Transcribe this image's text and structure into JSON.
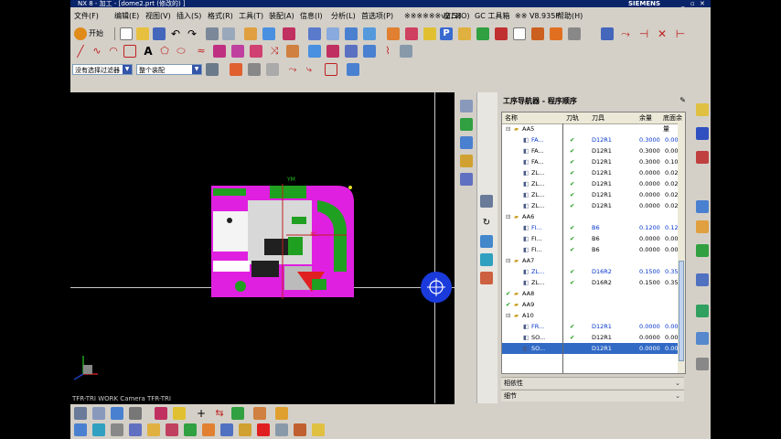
{
  "window": {
    "title": "NX 8 - 加工 - [dome2.prt (修改的) ]",
    "brand": "SIEMENS"
  },
  "menu": {
    "items": [
      "文件(F)",
      "编辑(E)",
      "视图(V)",
      "插入(S)",
      "格式(R)",
      "工具(T)",
      "装配(A)",
      "信息(I)",
      "分析(L)",
      "首选项(P)",
      "※※※※※※v2.58",
      "窗口(O)",
      "GC 工具箱",
      "※※ V8.935F",
      "帮助(H)"
    ]
  },
  "toolbar1": {
    "start_label": "开始"
  },
  "selection_bar": {
    "filter_value": "没有选择过滤器",
    "scope_value": "整个装配"
  },
  "viewport": {
    "status_text": "TFR-TRI WORK Camera TFR-TRI",
    "axis_label_ym": "YM",
    "axis_label_xc": "XC"
  },
  "navigator": {
    "title": "工序导航器 - 程序顺序",
    "columns": [
      "名称",
      "刀轨",
      "刀具",
      "余量",
      "底面余量"
    ],
    "rows": [
      {
        "indent": 1,
        "name": "AA5",
        "kind": "group",
        "check": "",
        "tool": "",
        "stock": "",
        "floor": "",
        "blue": false
      },
      {
        "indent": 2,
        "name": "FA...",
        "kind": "op",
        "check": "✔",
        "tool": "D12R1",
        "stock": "0.3000",
        "floor": "0.000",
        "blue": true
      },
      {
        "indent": 2,
        "name": "FA...",
        "kind": "op",
        "check": "✔",
        "tool": "D12R1",
        "stock": "0.3000",
        "floor": "0.000",
        "blue": false
      },
      {
        "indent": 2,
        "name": "FA...",
        "kind": "op",
        "check": "✔",
        "tool": "D12R1",
        "stock": "0.3000",
        "floor": "0.100",
        "blue": false
      },
      {
        "indent": 2,
        "name": "ZL...",
        "kind": "op",
        "check": "✔",
        "tool": "D12R1",
        "stock": "0.0000",
        "floor": "0.020",
        "blue": false
      },
      {
        "indent": 2,
        "name": "ZL...",
        "kind": "op",
        "check": "✔",
        "tool": "D12R1",
        "stock": "0.0000",
        "floor": "0.020",
        "blue": false
      },
      {
        "indent": 2,
        "name": "ZL...",
        "kind": "op",
        "check": "✔",
        "tool": "D12R1",
        "stock": "0.0000",
        "floor": "0.020",
        "blue": false
      },
      {
        "indent": 2,
        "name": "ZL...",
        "kind": "op",
        "check": "✔",
        "tool": "D12R1",
        "stock": "0.0000",
        "floor": "0.020",
        "blue": false
      },
      {
        "indent": 1,
        "name": "AA6",
        "kind": "group",
        "check": "",
        "tool": "",
        "stock": "",
        "floor": "",
        "blue": false
      },
      {
        "indent": 2,
        "name": "FI...",
        "kind": "op",
        "check": "✔",
        "tool": "B6",
        "stock": "0.1200",
        "floor": "0.120",
        "blue": true
      },
      {
        "indent": 2,
        "name": "FI...",
        "kind": "op",
        "check": "✔",
        "tool": "B6",
        "stock": "0.0000",
        "floor": "0.000",
        "blue": false
      },
      {
        "indent": 2,
        "name": "FI...",
        "kind": "op",
        "check": "✔",
        "tool": "B6",
        "stock": "0.0000",
        "floor": "0.000",
        "blue": false
      },
      {
        "indent": 1,
        "name": "AA7",
        "kind": "group",
        "check": "",
        "tool": "",
        "stock": "",
        "floor": "",
        "blue": false
      },
      {
        "indent": 2,
        "name": "ZL...",
        "kind": "op",
        "check": "✔",
        "tool": "D16R2",
        "stock": "0.1500",
        "floor": "0.350",
        "blue": true
      },
      {
        "indent": 2,
        "name": "ZL...",
        "kind": "op",
        "check": "✔",
        "tool": "D16R2",
        "stock": "0.1500",
        "floor": "0.350",
        "blue": false
      },
      {
        "indent": 1,
        "name": "AA8",
        "kind": "group-check",
        "check": "",
        "tool": "",
        "stock": "",
        "floor": "",
        "blue": false
      },
      {
        "indent": 1,
        "name": "AA9",
        "kind": "group-check",
        "check": "",
        "tool": "",
        "stock": "",
        "floor": "",
        "blue": false
      },
      {
        "indent": 1,
        "name": "A10",
        "kind": "group",
        "check": "",
        "tool": "",
        "stock": "",
        "floor": "",
        "blue": false
      },
      {
        "indent": 2,
        "name": "FR...",
        "kind": "op",
        "check": "✔",
        "tool": "D12R1",
        "stock": "0.0000",
        "floor": "0.000",
        "blue": true
      },
      {
        "indent": 2,
        "name": "SO...",
        "kind": "op",
        "check": "✔",
        "tool": "D12R1",
        "stock": "0.0000",
        "floor": "0.000",
        "blue": false
      },
      {
        "indent": 2,
        "name": "SO...",
        "kind": "op-selected",
        "check": "",
        "tool": "D12R1",
        "stock": "0.0000",
        "floor": "0.000",
        "blue": false
      }
    ],
    "sections": [
      "相依性",
      "细节"
    ]
  },
  "colors": {
    "viewport_bg": "#000000",
    "part_magenta": "#e020e0",
    "part_green": "#20a020",
    "selection_blue": "#316ac5",
    "check_green": "#1a9a1a",
    "csys_blue": "#1a3adc"
  }
}
